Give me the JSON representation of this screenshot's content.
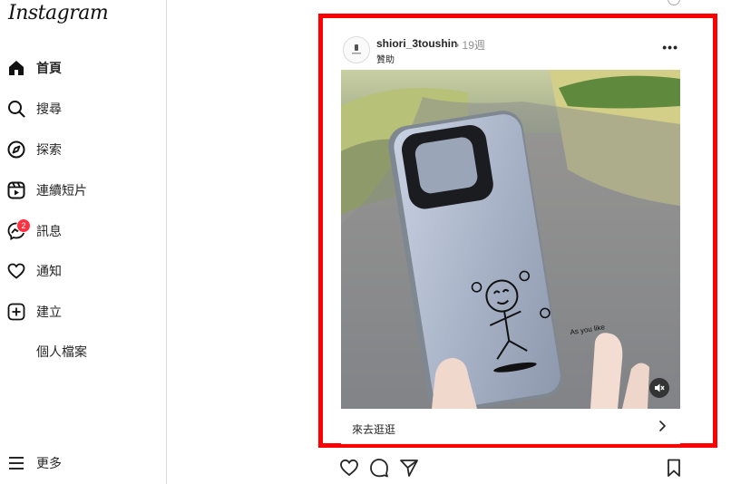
{
  "app": {
    "logo": "Instagram"
  },
  "sidebar": {
    "items": [
      {
        "label": "首頁",
        "icon": "home-icon"
      },
      {
        "label": "搜尋",
        "icon": "search-icon"
      },
      {
        "label": "探索",
        "icon": "compass-icon"
      },
      {
        "label": "連續短片",
        "icon": "reels-icon"
      },
      {
        "label": "訊息",
        "icon": "messenger-icon",
        "badge": "2"
      },
      {
        "label": "通知",
        "icon": "heart-icon"
      },
      {
        "label": "建立",
        "icon": "plus-square-icon"
      },
      {
        "label": "個人檔案",
        "icon": "avatar"
      }
    ],
    "more_label": "更多"
  },
  "post": {
    "username": "shiori_3toushin",
    "time": "• 19週",
    "sponsored": "贊助",
    "more": "•••",
    "media_text": "As you like",
    "cta_label": "來去逛逛"
  },
  "colors": {
    "highlight": "#ff0000",
    "badge": "#ff3040"
  }
}
